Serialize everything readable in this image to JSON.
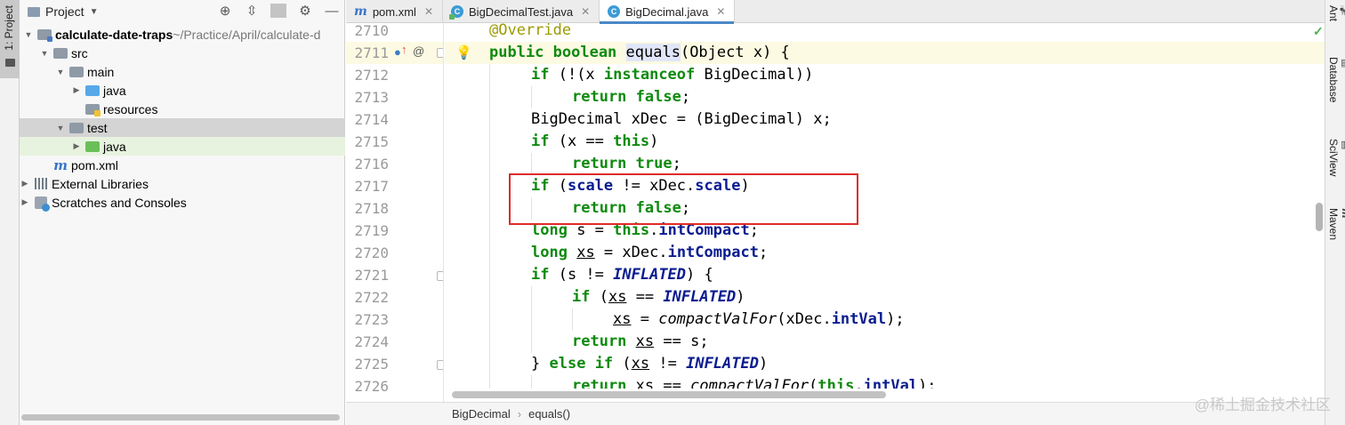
{
  "left_stripe": {
    "label": "1: Project"
  },
  "project_panel": {
    "title": "Project",
    "header_icons": [
      "target-icon",
      "collapse-icon",
      "gear-icon",
      "hide-icon"
    ],
    "tree": [
      {
        "label": "calculate-date-traps",
        "suffix": " ~/Practice/April/calculate-d",
        "icon": "module-folder-icon"
      },
      {
        "label": "src",
        "icon": "folder-icon"
      },
      {
        "label": "main",
        "icon": "folder-icon"
      },
      {
        "label": "java",
        "icon": "source-folder-icon"
      },
      {
        "label": "resources",
        "icon": "resources-folder-icon"
      },
      {
        "label": "test",
        "icon": "folder-icon"
      },
      {
        "label": "java",
        "icon": "test-source-folder-icon"
      },
      {
        "label": "pom.xml",
        "icon": "maven-icon"
      },
      {
        "label": "External Libraries",
        "icon": "library-icon"
      },
      {
        "label": "Scratches and Consoles",
        "icon": "scratches-icon"
      }
    ]
  },
  "tabs": [
    {
      "label": "pom.xml",
      "icon": "maven-icon",
      "active": false
    },
    {
      "label": "BigDecimalTest.java",
      "icon": "class-icon",
      "active": false
    },
    {
      "label": "BigDecimal.java",
      "icon": "class-icon",
      "active": true
    }
  ],
  "editor": {
    "line_numbers": [
      "2710",
      "2711",
      "2712",
      "2713",
      "2714",
      "2715",
      "2716",
      "2717",
      "2718",
      "2719",
      "2720",
      "2721",
      "2722",
      "2723",
      "2724",
      "2725",
      "2726"
    ],
    "current_line": "2711",
    "code": {
      "l2710": "@Override",
      "l2711_kw": "public boolean ",
      "l2711_name": "equals",
      "l2711_rest": "(Object x) {",
      "if": "if",
      "return": "return",
      "false": "false",
      "true": "true",
      "this": "this",
      "long": "long",
      "else": "else",
      "instanceof": "instanceof",
      "scale": "scale",
      "intCompact": "intCompact",
      "intVal": "intVal",
      "INFLATED": "INFLATED",
      "compactValFor": "compactValFor",
      "xs": "xs",
      "l2712_a": " (!(x ",
      "l2712_b": " BigDecimal))",
      "l2714": "BigDecimal xDec = (BigDecimal) x;",
      "l2715_a": " (x == ",
      "l2715_b": ")",
      "semi": ";",
      "sp": " ",
      "l2717_a": " (",
      "l2717_b": " != xDec.",
      "l2717_c": ")",
      "l2719_a": " s = ",
      "l2719_b": ".",
      "l2720_a": " = xDec.",
      "l2721_a": " (s != ",
      "l2721_b": ") {",
      "l2722_a": " (",
      "l2722_b": " == ",
      "l2722_c": ")",
      "l2723_a": " = ",
      "l2723_b": "(xDec.",
      "l2723_c": ");",
      "l2724_a": " == s;",
      "l2725_a": "} ",
      "l2725_b": " (",
      "l2725_c": " != ",
      "l2725_d": ")",
      "l2726_a": " == ",
      "l2726_b": "(",
      "l2726_c": ".",
      "l2726_d": ");"
    }
  },
  "right_stripe": [
    "Ant",
    "Database",
    "SciView",
    "Maven"
  ],
  "breadcrumb": [
    "BigDecimal",
    "equals()"
  ],
  "watermark": "@稀土掘金技术社区",
  "colors": {
    "keyword": "#0f8a0f",
    "field": "#0a1c8f",
    "annotation": "#9c9a00",
    "highlight_box": "#e02b2b",
    "tab_accent": "#4a88c7"
  }
}
